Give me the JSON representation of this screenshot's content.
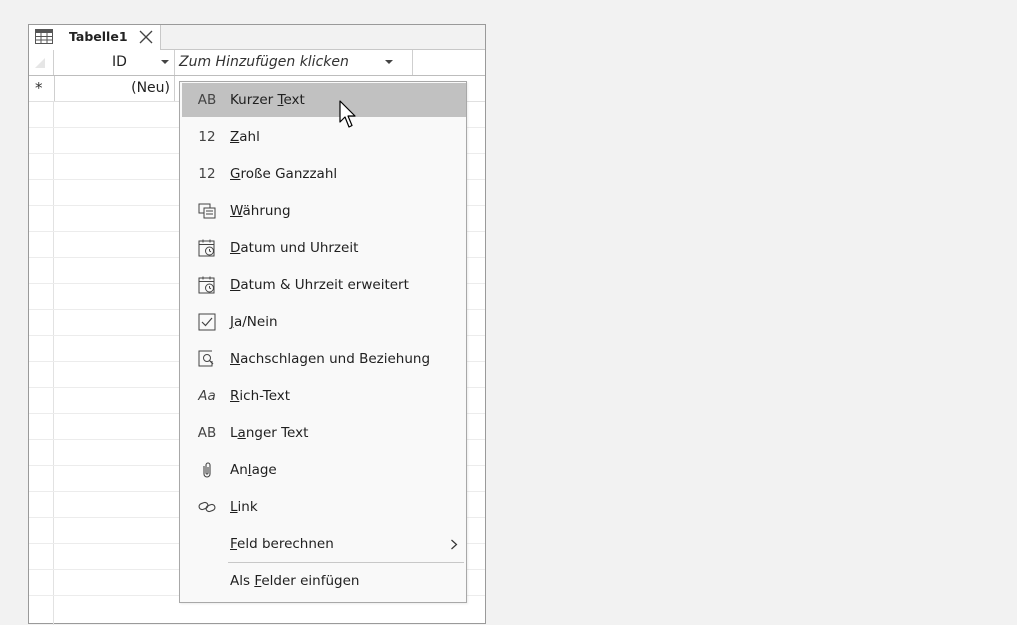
{
  "tab": {
    "label": "Tabelle1",
    "icon": "table-icon",
    "close_icon": "close-icon"
  },
  "header": {
    "id_label": "ID",
    "add_label": "Zum Hinzufügen klicken"
  },
  "new_row": {
    "marker": "*",
    "value": "(Neu)"
  },
  "menu": {
    "items": [
      {
        "icon": "AB",
        "icon_name": "short-text-icon",
        "pre": "Kurzer ",
        "ul": "T",
        "post": "ext",
        "hovered": true
      },
      {
        "icon": "12",
        "icon_name": "number-icon",
        "pre": "",
        "ul": "Z",
        "post": "ahl"
      },
      {
        "icon": "12",
        "icon_name": "large-number-icon",
        "pre": "",
        "ul": "G",
        "post": "roße Ganzzahl"
      },
      {
        "icon": "",
        "icon_name": "currency-icon",
        "pre": "",
        "ul": "W",
        "post": "ährung"
      },
      {
        "icon": "",
        "icon_name": "date-time-icon",
        "pre": "",
        "ul": "D",
        "post": "atum und Uhrzeit"
      },
      {
        "icon": "",
        "icon_name": "date-time-extended-icon",
        "pre": "",
        "ul": "D",
        "post": "atum & Uhrzeit erweitert"
      },
      {
        "icon": "",
        "icon_name": "yes-no-checkbox-icon",
        "pre": "",
        "ul": "J",
        "post": "a/Nein"
      },
      {
        "icon": "",
        "icon_name": "lookup-icon",
        "pre": "",
        "ul": "N",
        "post": "achschlagen und Beziehung"
      },
      {
        "icon": "Aa",
        "icon_name": "rich-text-icon",
        "pre": "",
        "ul": "R",
        "post": "ich-Text"
      },
      {
        "icon": "AB",
        "icon_name": "long-text-icon",
        "pre": "L",
        "ul": "a",
        "post": "nger Text"
      },
      {
        "icon": "",
        "icon_name": "attachment-icon",
        "pre": "An",
        "ul": "l",
        "post": "age"
      },
      {
        "icon": "",
        "icon_name": "link-icon",
        "pre": "",
        "ul": "L",
        "post": "ink"
      },
      {
        "icon": "",
        "icon_name": "",
        "pre": "",
        "ul": "F",
        "post": "eld berechnen",
        "submenu": true
      },
      {
        "icon": "",
        "icon_name": "",
        "pre": "Als ",
        "ul": "F",
        "post": "elder einfügen"
      }
    ]
  },
  "colors": {
    "hover": "#c1c1c1",
    "menu_bg": "#f9f9f9",
    "page_bg": "#f2f2f2"
  }
}
